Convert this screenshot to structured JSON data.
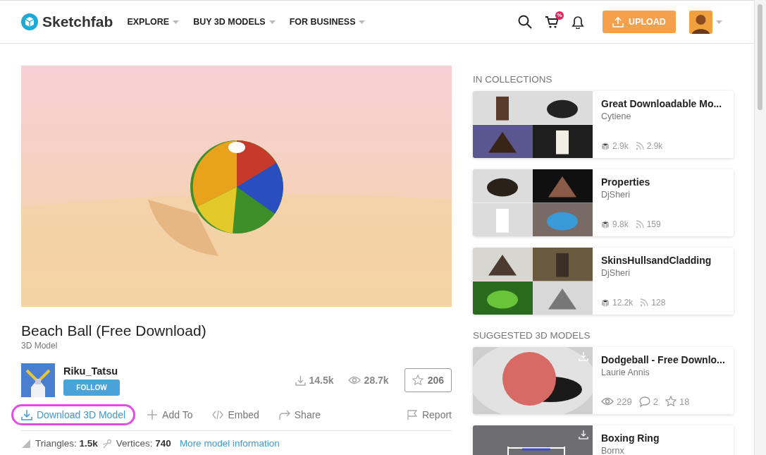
{
  "header": {
    "logo_text": "Sketchfab",
    "nav": [
      {
        "label": "EXPLORE"
      },
      {
        "label": "BUY 3D MODELS"
      },
      {
        "label": "FOR BUSINESS"
      }
    ],
    "cart_badge": "%",
    "upload_label": "UPLOAD"
  },
  "model": {
    "title": "Beach Ball (Free Download)",
    "subtitle": "3D Model",
    "author": {
      "name": "Riku_Tatsu",
      "follow_label": "FOLLOW"
    },
    "stats": {
      "downloads": "14.5k",
      "views": "28.7k",
      "likes": "206"
    },
    "actions": [
      {
        "kind": "download",
        "label": "Download 3D Model",
        "highlighted": true
      },
      {
        "kind": "add",
        "label": "Add To",
        "highlighted": false
      },
      {
        "kind": "embed",
        "label": "Embed",
        "highlighted": false
      },
      {
        "kind": "share",
        "label": "Share",
        "highlighted": false
      },
      {
        "kind": "report",
        "label": "Report",
        "highlighted": false
      }
    ],
    "info": {
      "triangles_label": "Triangles:",
      "triangles": "1.5k",
      "vertices_label": "Vertices:",
      "vertices": "740",
      "more_link": "More model information"
    }
  },
  "sidebar": {
    "collections_heading": "IN COLLECTIONS",
    "collections": [
      {
        "title": "Great Downloadable Mo...",
        "author": "Cytiene",
        "models": "2.9k",
        "followers": "2.9k"
      },
      {
        "title": "Properties",
        "author": "DjSheri",
        "models": "9.8k",
        "followers": "159"
      },
      {
        "title": "SkinsHullsandCladding",
        "author": "DjSheri",
        "models": "12.2k",
        "followers": "128"
      }
    ],
    "suggested_heading": "SUGGESTED 3D MODELS",
    "suggested": [
      {
        "title": "Dodgeball - Free Downlo...",
        "author": "Laurie Annis",
        "views": "229",
        "comments": "2",
        "likes": "18"
      },
      {
        "title": "Boxing Ring",
        "author": "Bornx"
      }
    ]
  }
}
